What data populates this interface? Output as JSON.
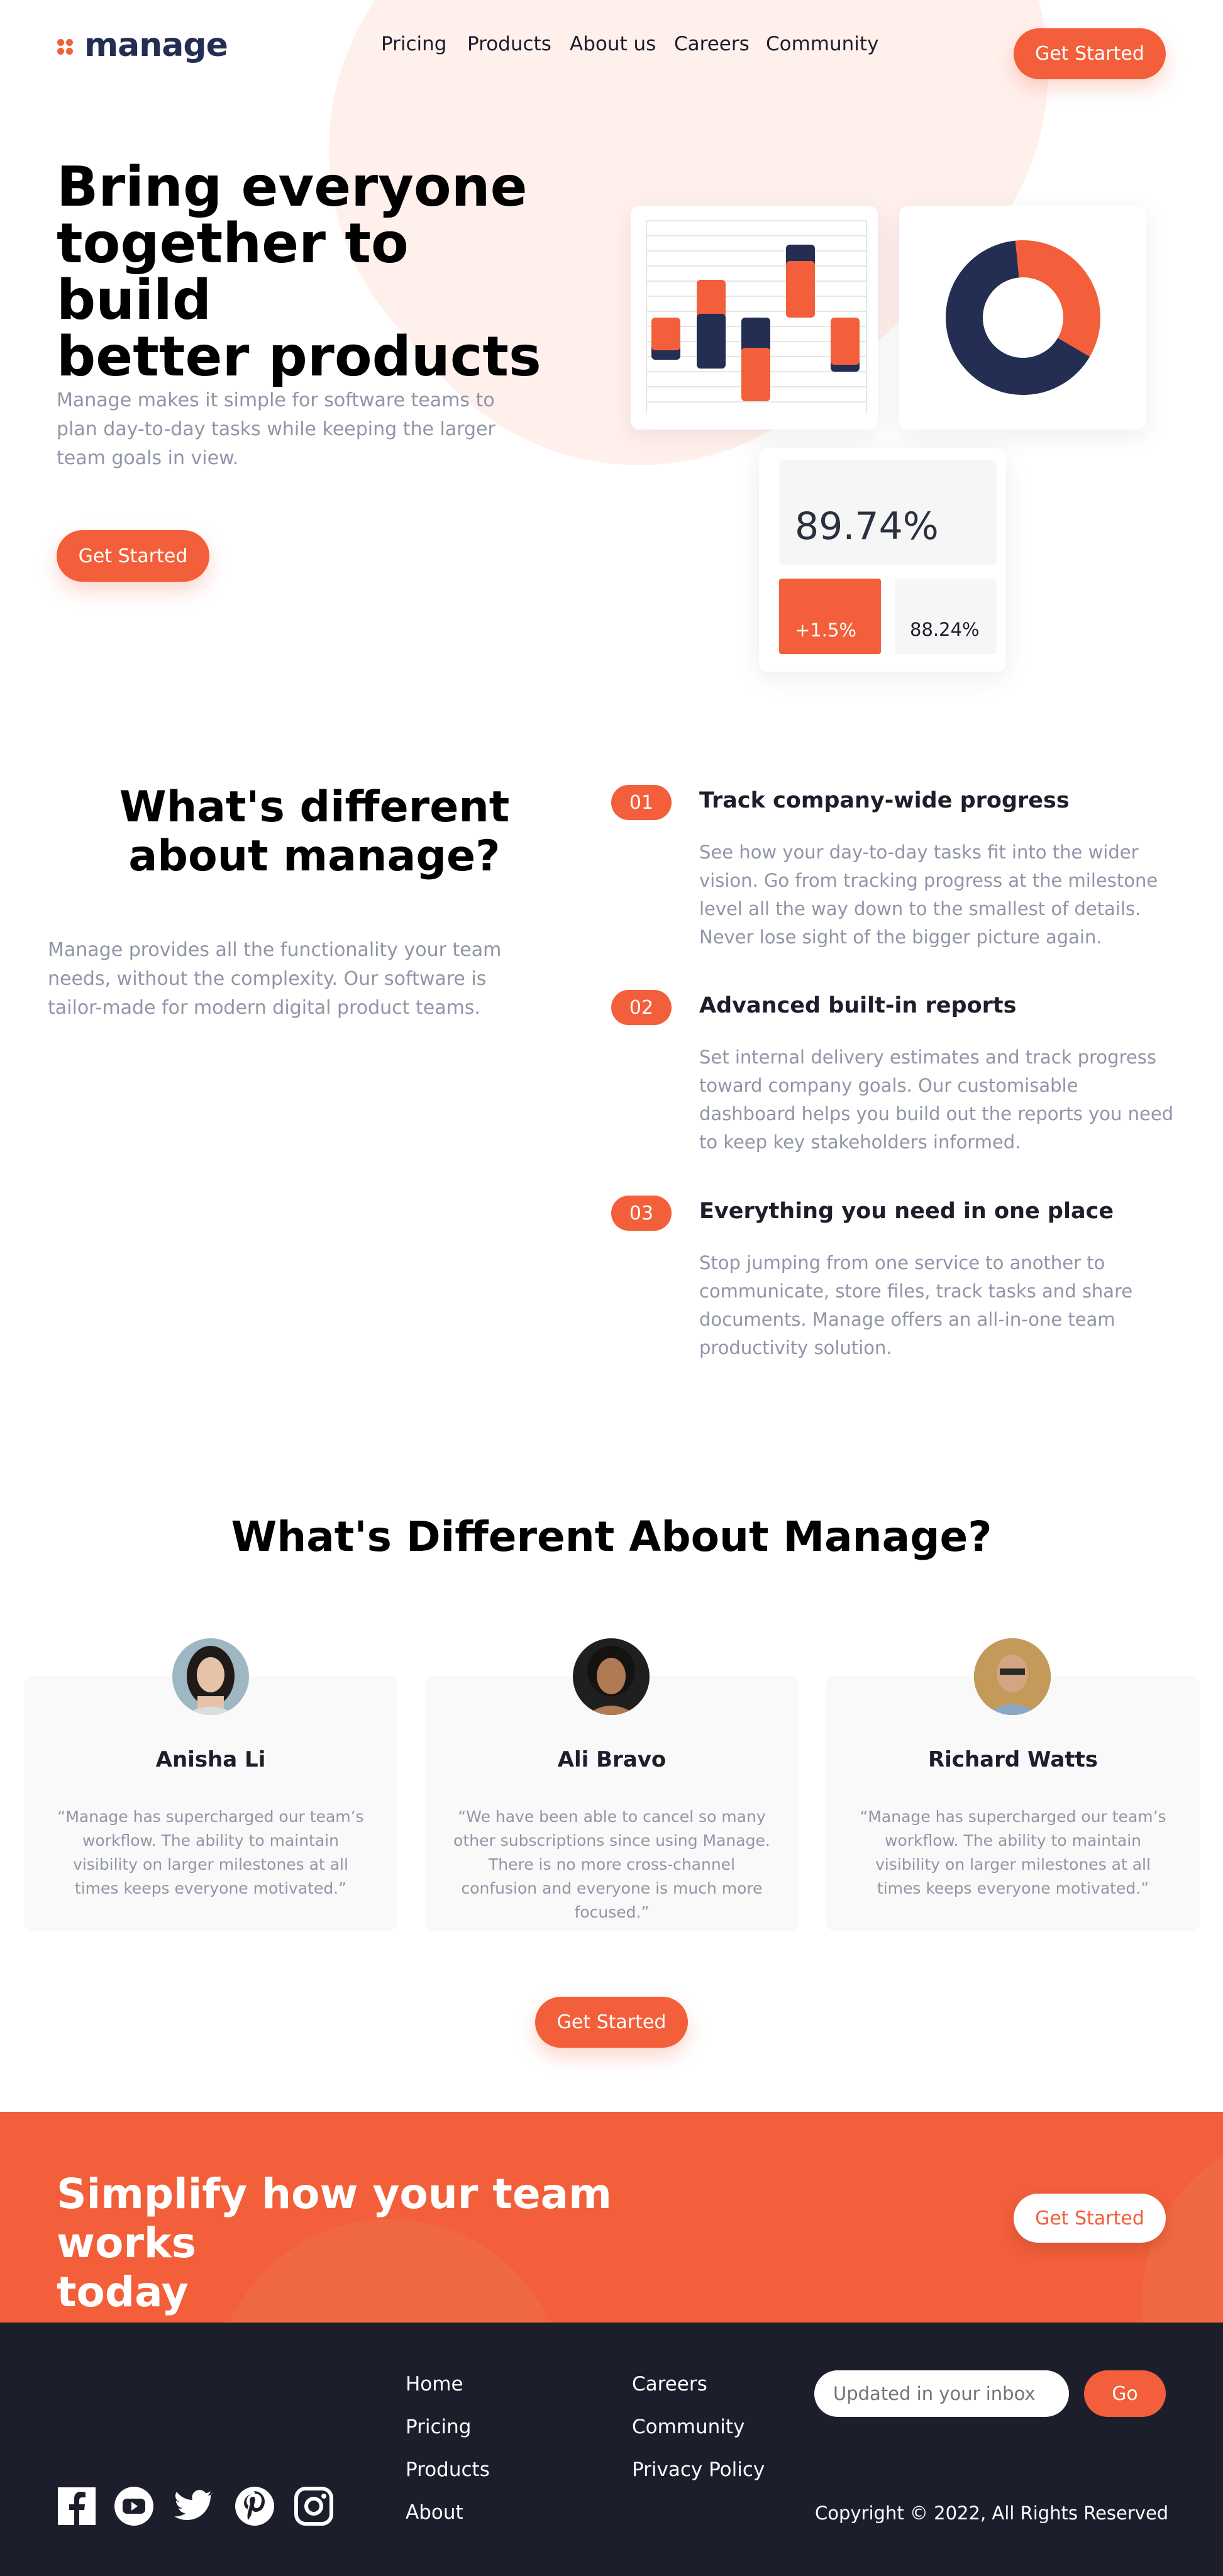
{
  "brand": {
    "name": "manage",
    "accent": "#f25f3a",
    "navy": "#242d52"
  },
  "nav": {
    "items": [
      "Pricing",
      "Products",
      "About us",
      "Careers",
      "Community"
    ],
    "cta": "Get Started"
  },
  "hero": {
    "title_lines": [
      "Bring everyone",
      "together to build",
      "better products"
    ],
    "subtitle": "Manage makes it simple for software teams to plan day-to-day tasks while keeping the larger team goals in view.",
    "cta": "Get Started",
    "stat_main": "89.74%",
    "stat_change": "+1.5%",
    "stat_secondary": "88.24%",
    "donut_segments": [
      {
        "label": "navy",
        "value": 65,
        "color": "#242d52"
      },
      {
        "label": "orange",
        "value": 35,
        "color": "#f25f3a"
      }
    ]
  },
  "different": {
    "title": "What's different about manage?",
    "text": "Manage provides all the functionality your team needs, without the complexity. Our software is tailor-made for modern digital product teams.",
    "features": [
      {
        "num": "01",
        "title": "Track company-wide progress",
        "desc": "See how your day-to-day tasks fit into the wider vision. Go from tracking progress at the milestone level all the way down to the smallest of details. Never lose sight of the bigger picture again."
      },
      {
        "num": "02",
        "title": "Advanced built-in reports",
        "desc": "Set internal delivery estimates and track progress toward company goals. Our customisable dashboard helps you build out the reports you need to keep key stakeholders informed."
      },
      {
        "num": "03",
        "title": "Everything you need in one place",
        "desc": "Stop jumping from one service to another to communicate, store files, track tasks and share documents. Manage offers an all-in-one team productivity solution."
      }
    ]
  },
  "testimonials": {
    "title": "What's Different About Manage?",
    "items": [
      {
        "name": "Anisha Li",
        "quote": "“Manage has supercharged our team’s workflow. The ability to maintain visibility on larger milestones at all times keeps everyone motivated.”"
      },
      {
        "name": "Ali Bravo",
        "quote": "“We have been able to cancel so many other subscriptions since using Manage. There is no more cross-channel confusion and everyone is much more focused.”"
      },
      {
        "name": "Richard Watts",
        "quote": "“Manage has supercharged our team’s workflow. The ability to maintain visibility on larger milestones at all times keeps everyone motivated.”"
      }
    ],
    "cta": "Get Started"
  },
  "cta_band": {
    "title_lines": [
      "Simplify how your team works",
      "today"
    ],
    "button": "Get Started"
  },
  "footer": {
    "links_col1": [
      "Home",
      "Pricing",
      "Products",
      "About"
    ],
    "links_col2": [
      "Careers",
      "Community",
      "Privacy Policy"
    ],
    "newsletter_placeholder": "Updated in your inbox",
    "newsletter_button": "Go",
    "copyright": "Copyright © 2022, All Rights Reserved",
    "social_icons": [
      "facebook-icon",
      "youtube-icon",
      "twitter-icon",
      "pinterest-icon",
      "instagram-icon"
    ]
  }
}
